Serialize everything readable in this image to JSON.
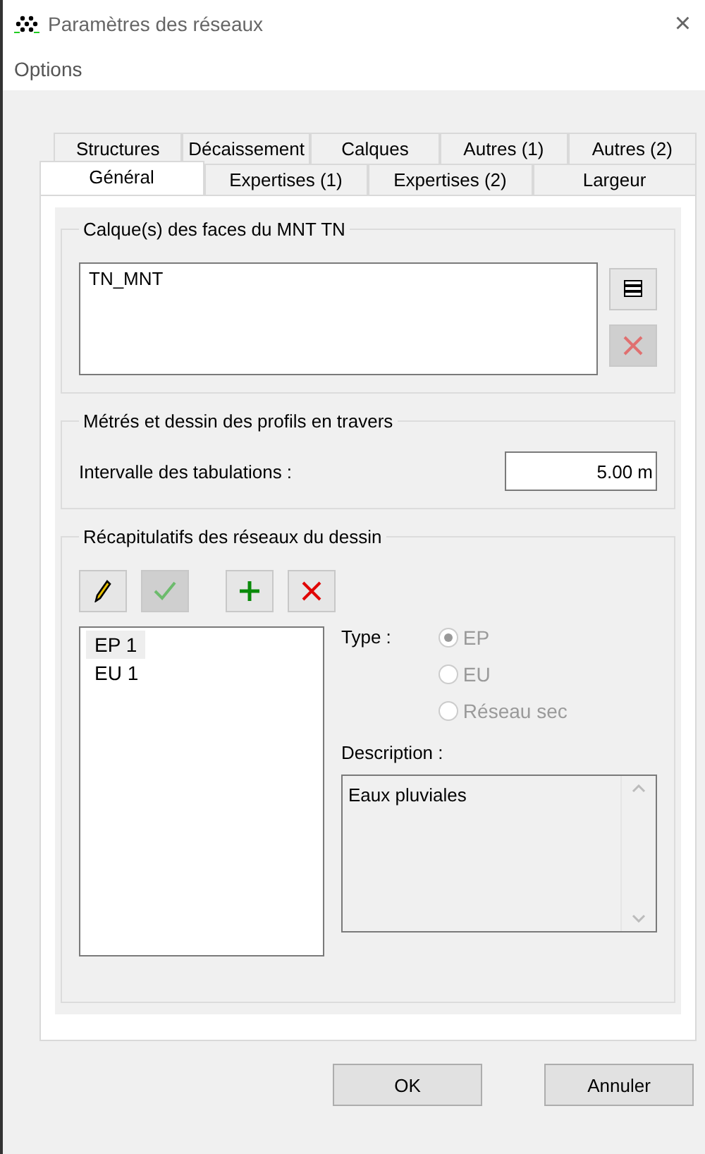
{
  "window": {
    "title": "Paramètres des réseaux",
    "close": "×"
  },
  "menu": [
    "Options"
  ],
  "tab_rows": [
    [
      {
        "label": "Structures",
        "selected": false
      },
      {
        "label": "Décaissement",
        "selected": false
      },
      {
        "label": "Calques",
        "selected": false
      },
      {
        "label": "Autres (1)",
        "selected": false
      },
      {
        "label": "Autres (2)",
        "selected": false
      }
    ],
    [
      {
        "label": "Général",
        "selected": true
      },
      {
        "label": "Expertises (1)",
        "selected": false
      },
      {
        "label": "Expertises (2)",
        "selected": false
      },
      {
        "label": "Largeur",
        "selected": false
      }
    ]
  ],
  "layers_group": {
    "title": "Calque(s) des faces du MNT TN",
    "items": [
      "TN_MNT"
    ],
    "buttons": [
      {
        "kind": "layers",
        "disabled": false
      },
      {
        "kind": "delete",
        "disabled": true
      }
    ]
  },
  "metrics_group": {
    "title": "Métrés et dessin des profils en travers",
    "label": "Intervalle des tabulations :",
    "value": "5.00 m"
  },
  "networks_group": {
    "title": "Récapitulatifs des réseaux du dessin",
    "toolbar": [
      {
        "kind": "edit",
        "disabled": false
      },
      {
        "kind": "apply",
        "disabled": true
      },
      {
        "kind": "add",
        "disabled": false
      },
      {
        "kind": "delete",
        "disabled": false
      }
    ],
    "networks": [
      {
        "label": "EP 1",
        "selected": true
      },
      {
        "label": "EU 1",
        "selected": false
      }
    ],
    "type_label": "Type :",
    "types": [
      {
        "label": "EP",
        "selected": true,
        "disabled": true
      },
      {
        "label": "EU",
        "selected": false,
        "disabled": true
      },
      {
        "label": "Réseau sec",
        "selected": false,
        "disabled": true
      }
    ],
    "description_label": "Description :",
    "description": "Eaux pluviales"
  },
  "buttons": [
    "OK",
    "Annuler"
  ]
}
